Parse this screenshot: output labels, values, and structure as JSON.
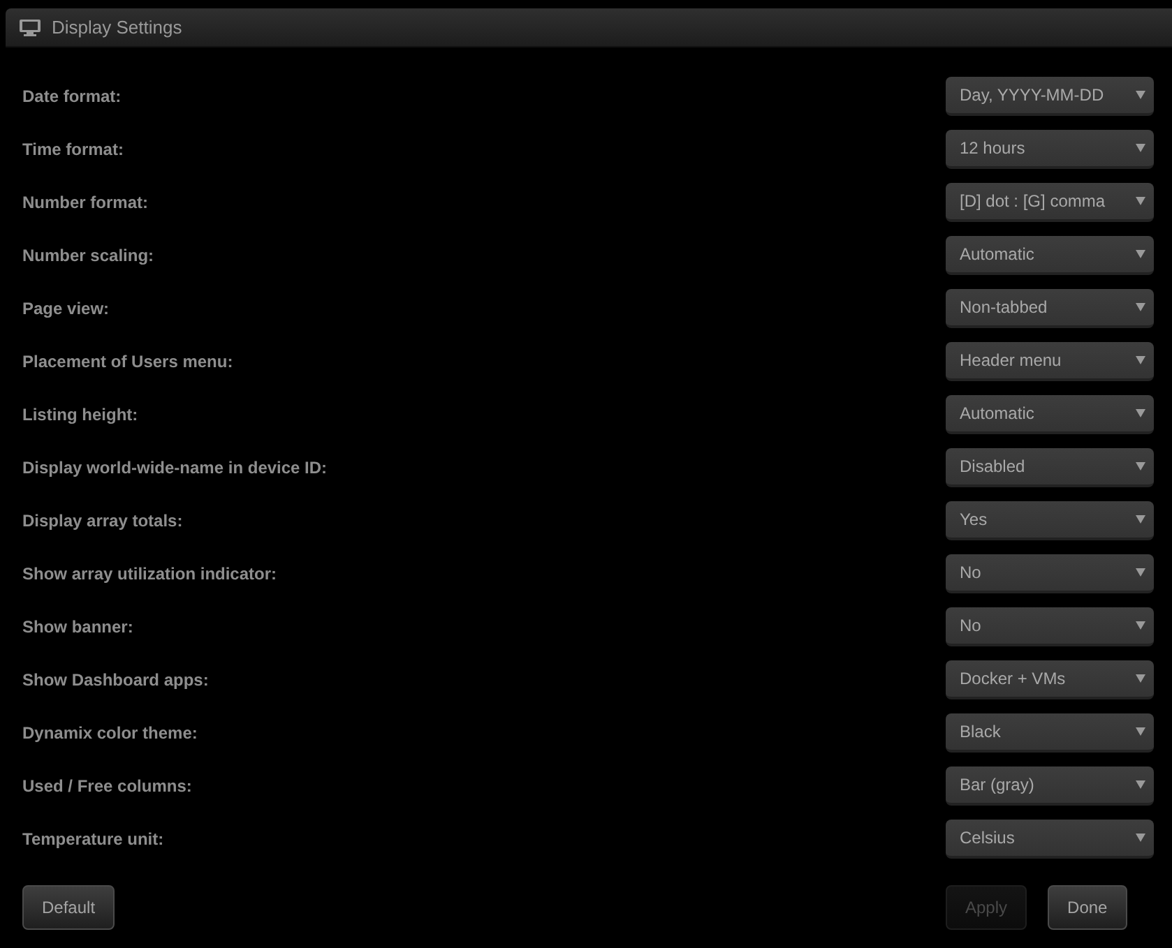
{
  "panel": {
    "title": "Display Settings"
  },
  "settings": [
    {
      "label": "Date format:",
      "value": "Day, YYYY-MM-DD"
    },
    {
      "label": "Time format:",
      "value": "12 hours"
    },
    {
      "label": "Number format:",
      "value": "[D] dot : [G] comma"
    },
    {
      "label": "Number scaling:",
      "value": "Automatic"
    },
    {
      "label": "Page view:",
      "value": "Non-tabbed"
    },
    {
      "label": "Placement of Users menu:",
      "value": "Header menu"
    },
    {
      "label": "Listing height:",
      "value": "Automatic"
    },
    {
      "label": "Display world-wide-name in device ID:",
      "value": "Disabled"
    },
    {
      "label": "Display array totals:",
      "value": "Yes"
    },
    {
      "label": "Show array utilization indicator:",
      "value": "No"
    },
    {
      "label": "Show banner:",
      "value": "No"
    },
    {
      "label": "Show Dashboard apps:",
      "value": "Docker + VMs"
    },
    {
      "label": "Dynamix color theme:",
      "value": "Black"
    },
    {
      "label": "Used / Free columns:",
      "value": "Bar (gray)"
    },
    {
      "label": "Temperature unit:",
      "value": "Celsius"
    }
  ],
  "buttons": [
    {
      "label": "Default",
      "disabled": false
    },
    {
      "label": "Apply",
      "disabled": true
    },
    {
      "label": "Done",
      "disabled": false
    }
  ]
}
